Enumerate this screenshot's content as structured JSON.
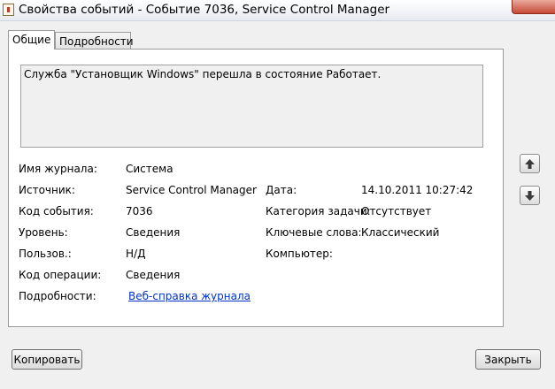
{
  "window": {
    "title": "Свойства событий - Событие 7036, Service Control Manager",
    "icon": "event-properties-icon"
  },
  "tabs": [
    {
      "label": "Общие",
      "active": true
    },
    {
      "label": "Подробности",
      "active": false
    }
  ],
  "description": "Служба \"Установщик Windows\" перешла в состояние Работает.",
  "fields": {
    "log_name_label": "Имя журнала:",
    "log_name": "Система",
    "source_label": "Источник:",
    "source": "Service Control Manager",
    "date_label": "Дата:",
    "date": "14.10.2011 10:27:42",
    "event_id_label": "Код события:",
    "event_id": "7036",
    "task_category_label": "Категория задачи:",
    "task_category": "Отсутствует",
    "level_label": "Уровень:",
    "level": "Сведения",
    "keywords_label": "Ключевые слова:",
    "keywords": "Классический",
    "user_label": "Пользов.:",
    "user": "Н/Д",
    "computer_label": "Компьютер:",
    "computer": "",
    "opcode_label": "Код операции:",
    "opcode": "Сведения",
    "details_label": "Подробности:",
    "details_link": "Веб-справка журнала"
  },
  "nav": {
    "up_icon": "arrow-up-icon",
    "down_icon": "arrow-down-icon"
  },
  "buttons": {
    "copy": "Копировать",
    "close": "Закрыть"
  }
}
